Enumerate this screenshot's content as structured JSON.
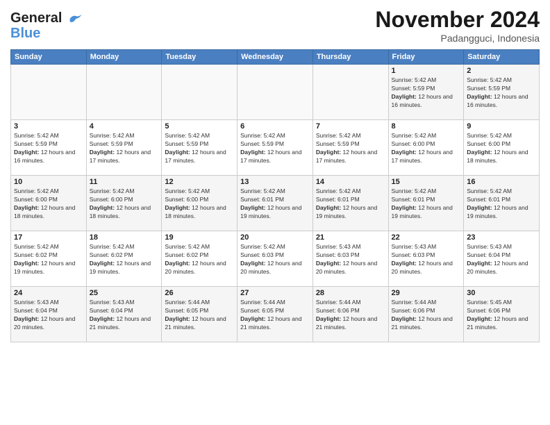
{
  "header": {
    "logo_line1": "General",
    "logo_line2": "Blue",
    "month_title": "November 2024",
    "location": "Padangguci, Indonesia"
  },
  "calendar": {
    "days_of_week": [
      "Sunday",
      "Monday",
      "Tuesday",
      "Wednesday",
      "Thursday",
      "Friday",
      "Saturday"
    ],
    "weeks": [
      [
        {
          "day": "",
          "info": ""
        },
        {
          "day": "",
          "info": ""
        },
        {
          "day": "",
          "info": ""
        },
        {
          "day": "",
          "info": ""
        },
        {
          "day": "",
          "info": ""
        },
        {
          "day": "1",
          "info": "Sunrise: 5:42 AM\nSunset: 5:59 PM\nDaylight: 12 hours and 16 minutes."
        },
        {
          "day": "2",
          "info": "Sunrise: 5:42 AM\nSunset: 5:59 PM\nDaylight: 12 hours and 16 minutes."
        }
      ],
      [
        {
          "day": "3",
          "info": "Sunrise: 5:42 AM\nSunset: 5:59 PM\nDaylight: 12 hours and 16 minutes."
        },
        {
          "day": "4",
          "info": "Sunrise: 5:42 AM\nSunset: 5:59 PM\nDaylight: 12 hours and 17 minutes."
        },
        {
          "day": "5",
          "info": "Sunrise: 5:42 AM\nSunset: 5:59 PM\nDaylight: 12 hours and 17 minutes."
        },
        {
          "day": "6",
          "info": "Sunrise: 5:42 AM\nSunset: 5:59 PM\nDaylight: 12 hours and 17 minutes."
        },
        {
          "day": "7",
          "info": "Sunrise: 5:42 AM\nSunset: 5:59 PM\nDaylight: 12 hours and 17 minutes."
        },
        {
          "day": "8",
          "info": "Sunrise: 5:42 AM\nSunset: 6:00 PM\nDaylight: 12 hours and 17 minutes."
        },
        {
          "day": "9",
          "info": "Sunrise: 5:42 AM\nSunset: 6:00 PM\nDaylight: 12 hours and 18 minutes."
        }
      ],
      [
        {
          "day": "10",
          "info": "Sunrise: 5:42 AM\nSunset: 6:00 PM\nDaylight: 12 hours and 18 minutes."
        },
        {
          "day": "11",
          "info": "Sunrise: 5:42 AM\nSunset: 6:00 PM\nDaylight: 12 hours and 18 minutes."
        },
        {
          "day": "12",
          "info": "Sunrise: 5:42 AM\nSunset: 6:00 PM\nDaylight: 12 hours and 18 minutes."
        },
        {
          "day": "13",
          "info": "Sunrise: 5:42 AM\nSunset: 6:01 PM\nDaylight: 12 hours and 19 minutes."
        },
        {
          "day": "14",
          "info": "Sunrise: 5:42 AM\nSunset: 6:01 PM\nDaylight: 12 hours and 19 minutes."
        },
        {
          "day": "15",
          "info": "Sunrise: 5:42 AM\nSunset: 6:01 PM\nDaylight: 12 hours and 19 minutes."
        },
        {
          "day": "16",
          "info": "Sunrise: 5:42 AM\nSunset: 6:01 PM\nDaylight: 12 hours and 19 minutes."
        }
      ],
      [
        {
          "day": "17",
          "info": "Sunrise: 5:42 AM\nSunset: 6:02 PM\nDaylight: 12 hours and 19 minutes."
        },
        {
          "day": "18",
          "info": "Sunrise: 5:42 AM\nSunset: 6:02 PM\nDaylight: 12 hours and 19 minutes."
        },
        {
          "day": "19",
          "info": "Sunrise: 5:42 AM\nSunset: 6:02 PM\nDaylight: 12 hours and 20 minutes."
        },
        {
          "day": "20",
          "info": "Sunrise: 5:42 AM\nSunset: 6:03 PM\nDaylight: 12 hours and 20 minutes."
        },
        {
          "day": "21",
          "info": "Sunrise: 5:43 AM\nSunset: 6:03 PM\nDaylight: 12 hours and 20 minutes."
        },
        {
          "day": "22",
          "info": "Sunrise: 5:43 AM\nSunset: 6:03 PM\nDaylight: 12 hours and 20 minutes."
        },
        {
          "day": "23",
          "info": "Sunrise: 5:43 AM\nSunset: 6:04 PM\nDaylight: 12 hours and 20 minutes."
        }
      ],
      [
        {
          "day": "24",
          "info": "Sunrise: 5:43 AM\nSunset: 6:04 PM\nDaylight: 12 hours and 20 minutes."
        },
        {
          "day": "25",
          "info": "Sunrise: 5:43 AM\nSunset: 6:04 PM\nDaylight: 12 hours and 21 minutes."
        },
        {
          "day": "26",
          "info": "Sunrise: 5:44 AM\nSunset: 6:05 PM\nDaylight: 12 hours and 21 minutes."
        },
        {
          "day": "27",
          "info": "Sunrise: 5:44 AM\nSunset: 6:05 PM\nDaylight: 12 hours and 21 minutes."
        },
        {
          "day": "28",
          "info": "Sunrise: 5:44 AM\nSunset: 6:06 PM\nDaylight: 12 hours and 21 minutes."
        },
        {
          "day": "29",
          "info": "Sunrise: 5:44 AM\nSunset: 6:06 PM\nDaylight: 12 hours and 21 minutes."
        },
        {
          "day": "30",
          "info": "Sunrise: 5:45 AM\nSunset: 6:06 PM\nDaylight: 12 hours and 21 minutes."
        }
      ]
    ]
  }
}
